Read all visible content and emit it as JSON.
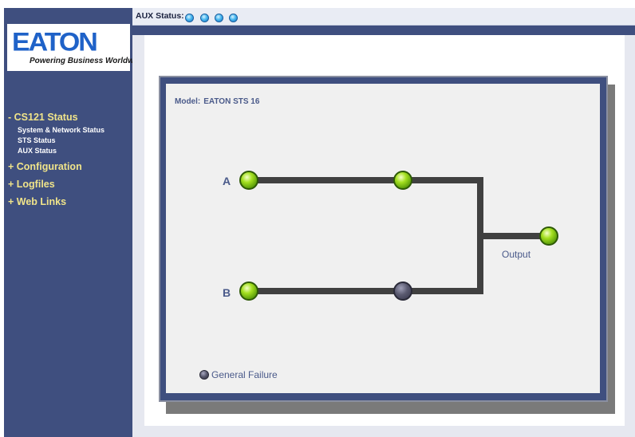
{
  "logo": {
    "brand": "EATON",
    "tagline": "Powering Business Worldwide"
  },
  "nav": {
    "cs121_status": "- CS121 Status",
    "sub_items": [
      "System & Network Status",
      "STS Status",
      "AUX Status"
    ],
    "configuration": "+ Configuration",
    "logfiles": "+ Logfiles",
    "web_links": "+ Web Links"
  },
  "topbar": {
    "aux_label": "AUX Status:",
    "aux_leds": [
      "on",
      "on",
      "on",
      "on"
    ],
    "aux_led_color": "#4ab8f0"
  },
  "diagram": {
    "model_label": "Model:",
    "model_value": "EATON STS 16",
    "input_a_label": "A",
    "input_b_label": "B",
    "output_label": "Output",
    "legend_label": "General Failure",
    "leds": {
      "input_a": "green",
      "switch_a": "green",
      "input_b": "green",
      "switch_b": "off",
      "output": "green",
      "general_failure": "off"
    }
  },
  "colors": {
    "sidebar": "#3f4f7f",
    "nav_section": "#f0e48a",
    "led_green": "#a4e020",
    "led_off": "#5a5a70",
    "line": "#404040"
  }
}
